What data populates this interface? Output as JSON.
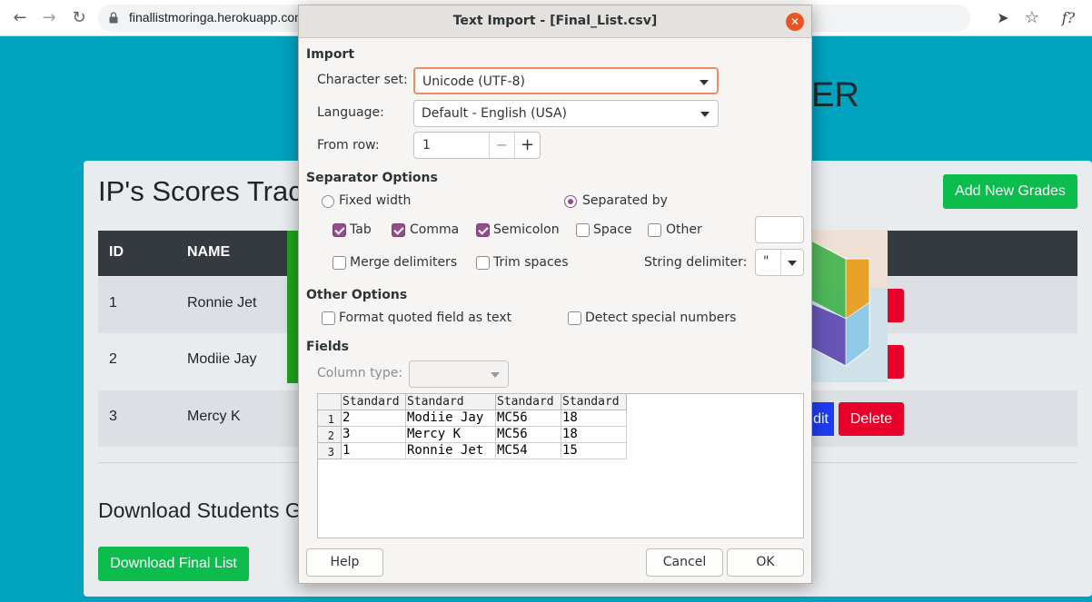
{
  "browser": {
    "url": "finallistmoringa.herokuapp.com",
    "back_icon": "arrow-left",
    "forward_icon": "arrow-right",
    "reload_icon": "reload",
    "extension_label": "f?"
  },
  "page": {
    "heading_fragment": "ER",
    "card_title": "IP's Scores Trac",
    "add_button": "Add New Grades",
    "table": {
      "headers": [
        "ID",
        "NAME"
      ],
      "rows": [
        {
          "id": "1",
          "name": "Ronnie Jet",
          "action_fragment": "e"
        },
        {
          "id": "2",
          "name": "Modiie Jay",
          "action_fragment": "e"
        },
        {
          "id": "3",
          "name": "Mercy K",
          "edit_fragment": "dit",
          "delete": "Delete"
        }
      ]
    },
    "download_title": "Download Students G",
    "download_button": "Download Final List"
  },
  "dialog": {
    "title": "Text Import - [Final_List.csv]",
    "import": {
      "section": "Import",
      "charset_label": "Character set:",
      "charset_value": "Unicode (UTF-8)",
      "language_label": "Language:",
      "language_value": "Default - English (USA)",
      "from_row_label": "From row:",
      "from_row_value": "1"
    },
    "separator": {
      "section": "Separator Options",
      "fixed_width": "Fixed width",
      "separated_by": "Separated by",
      "mode": "separated_by",
      "tab": "Tab",
      "comma": "Comma",
      "semicolon": "Semicolon",
      "space": "Space",
      "other": "Other",
      "merge": "Merge delimiters",
      "trim": "Trim spaces",
      "string_delim_label": "String delimiter:",
      "string_delim_value": "\"",
      "checked": {
        "tab": true,
        "comma": true,
        "semicolon": true,
        "space": false,
        "other": false,
        "merge": false,
        "trim": false
      }
    },
    "other_options": {
      "section": "Other Options",
      "format_quoted": "Format quoted field as text",
      "detect_special": "Detect special numbers"
    },
    "fields": {
      "section": "Fields",
      "column_type_label": "Column type:",
      "column_type_value": "",
      "headers": [
        "Standard",
        "Standard",
        "Standard",
        "Standard"
      ],
      "row_numbers": [
        "1",
        "2",
        "3"
      ],
      "rows": [
        [
          "2",
          "Modiie Jay",
          "MC56",
          "18"
        ],
        [
          "3",
          "Mercy K",
          "MC56",
          "18"
        ],
        [
          "1",
          "Ronnie Jet",
          "MC54",
          "15"
        ]
      ]
    },
    "buttons": {
      "help": "Help",
      "cancel": "Cancel",
      "ok": "OK"
    }
  },
  "colors": {
    "page_background": "#00a3bf",
    "accent_purple": "#924d8b",
    "success_green": "#0cbd4e",
    "danger_red": "#e8002b",
    "close_orange": "#e95420"
  }
}
